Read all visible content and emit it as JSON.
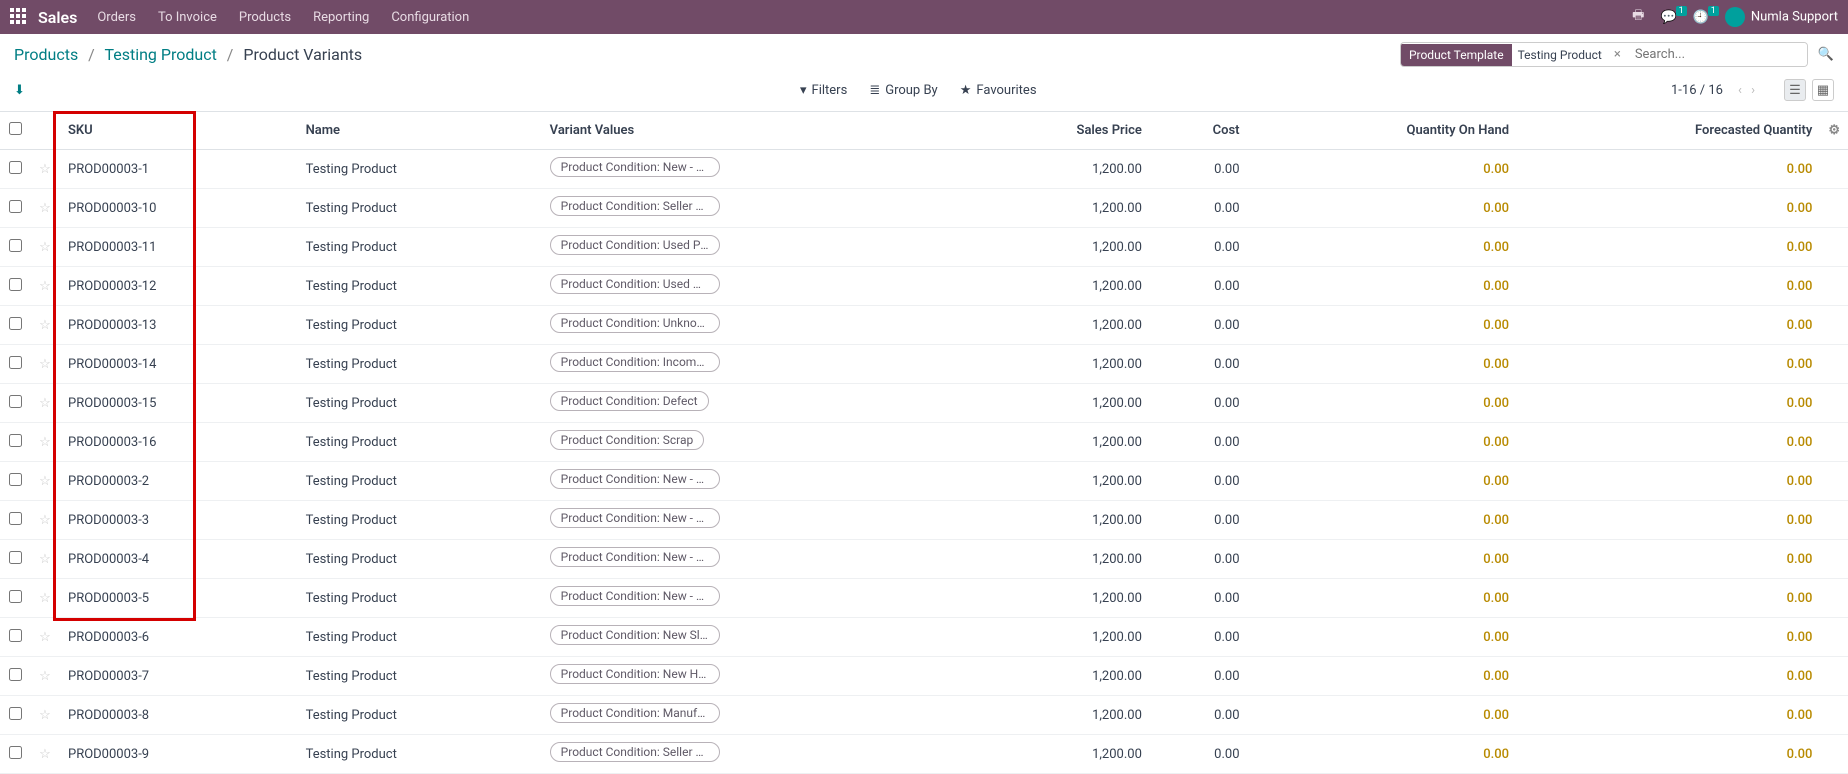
{
  "nav": {
    "brand": "Sales",
    "menu": [
      "Orders",
      "To Invoice",
      "Products",
      "Reporting",
      "Configuration"
    ],
    "msg_badge": "1",
    "act_badge": "1",
    "user": "Numla Support"
  },
  "breadcrumb": {
    "link1": "Products",
    "link2": "Testing Product",
    "current": "Product Variants"
  },
  "search": {
    "facet_label": "Product Template",
    "facet_value": "Testing Product",
    "placeholder": "Search..."
  },
  "filters": {
    "filters_label": "Filters",
    "groupby_label": "Group By",
    "fav_label": "Favourites"
  },
  "pager": {
    "text": "1-16 / 16"
  },
  "columns": {
    "sku": "SKU",
    "name": "Name",
    "variant": "Variant Values",
    "price": "Sales Price",
    "cost": "Cost",
    "qty": "Quantity On Hand",
    "forecast": "Forecasted Quantity"
  },
  "rows": [
    {
      "sku": "PROD00003-1",
      "name": "Testing Product",
      "variant": "Product Condition: New - Original...",
      "price": "1,200.00",
      "cost": "0.00",
      "qty": "0.00",
      "forecast": "0.00"
    },
    {
      "sku": "PROD00003-10",
      "name": "Testing Product",
      "variant": "Product Condition: Seller Refurbi...",
      "price": "1,200.00",
      "cost": "0.00",
      "qty": "0.00",
      "forecast": "0.00"
    },
    {
      "sku": "PROD00003-11",
      "name": "Testing Product",
      "variant": "Product Condition: Used Poor",
      "price": "1,200.00",
      "cost": "0.00",
      "qty": "0.00",
      "forecast": "0.00"
    },
    {
      "sku": "PROD00003-12",
      "name": "Testing Product",
      "variant": "Product Condition: Used Damaged",
      "price": "1,200.00",
      "cost": "0.00",
      "qty": "0.00",
      "forecast": "0.00"
    },
    {
      "sku": "PROD00003-13",
      "name": "Testing Product",
      "variant": "Product Condition: Unknown",
      "price": "1,200.00",
      "cost": "0.00",
      "qty": "0.00",
      "forecast": "0.00"
    },
    {
      "sku": "PROD00003-14",
      "name": "Testing Product",
      "variant": "Product Condition: Incomplete",
      "price": "1,200.00",
      "cost": "0.00",
      "qty": "0.00",
      "forecast": "0.00"
    },
    {
      "sku": "PROD00003-15",
      "name": "Testing Product",
      "variant": "Product Condition: Defect",
      "price": "1,200.00",
      "cost": "0.00",
      "qty": "0.00",
      "forecast": "0.00"
    },
    {
      "sku": "PROD00003-16",
      "name": "Testing Product",
      "variant": "Product Condition: Scrap",
      "price": "1,200.00",
      "cost": "0.00",
      "qty": "0.00",
      "forecast": "0.00"
    },
    {
      "sku": "PROD00003-2",
      "name": "Testing Product",
      "variant": "Product Condition: New - Original...",
      "price": "1,200.00",
      "cost": "0.00",
      "qty": "0.00",
      "forecast": "0.00"
    },
    {
      "sku": "PROD00003-3",
      "name": "Testing Product",
      "variant": "Product Condition: New - Slightly ...",
      "price": "1,200.00",
      "cost": "0.00",
      "qty": "0.00",
      "forecast": "0.00"
    },
    {
      "sku": "PROD00003-4",
      "name": "Testing Product",
      "variant": "Product Condition: New - Heavy ...",
      "price": "1,200.00",
      "cost": "0.00",
      "qty": "0.00",
      "forecast": "0.00"
    },
    {
      "sku": "PROD00003-5",
      "name": "Testing Product",
      "variant": "Product Condition: New - No Box",
      "price": "1,200.00",
      "cost": "0.00",
      "qty": "0.00",
      "forecast": "0.00"
    },
    {
      "sku": "PROD00003-6",
      "name": "Testing Product",
      "variant": "Product Condition: New Slightly ...",
      "price": "1,200.00",
      "cost": "0.00",
      "qty": "0.00",
      "forecast": "0.00"
    },
    {
      "sku": "PROD00003-7",
      "name": "Testing Product",
      "variant": "Product Condition: New Heavy Da...",
      "price": "1,200.00",
      "cost": "0.00",
      "qty": "0.00",
      "forecast": "0.00"
    },
    {
      "sku": "PROD00003-8",
      "name": "Testing Product",
      "variant": "Product Condition: Manufacturer ...",
      "price": "1,200.00",
      "cost": "0.00",
      "qty": "0.00",
      "forecast": "0.00"
    },
    {
      "sku": "PROD00003-9",
      "name": "Testing Product",
      "variant": "Product Condition: Seller Refurbi...",
      "price": "1,200.00",
      "cost": "0.00",
      "qty": "0.00",
      "forecast": "0.00"
    }
  ]
}
